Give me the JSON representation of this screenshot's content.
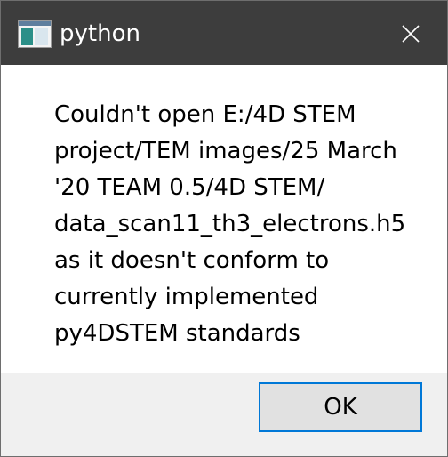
{
  "window": {
    "title": "python",
    "app_icon": "python-window-icon",
    "close_icon": "close-icon"
  },
  "message": {
    "lines": [
      "Couldn't open E:/4D STEM",
      "project/TEM images/25 March",
      "'20 TEAM 0.5/4D STEM/",
      "data_scan11_th3_electrons.h5",
      "as it doesn't conform to",
      "currently implemented",
      "py4DSTEM standards"
    ]
  },
  "buttons": {
    "ok_label": "OK"
  },
  "colors": {
    "titlebar": "#3d3d3d",
    "footer": "#f0f0f0",
    "focus_border": "#0078d7"
  }
}
